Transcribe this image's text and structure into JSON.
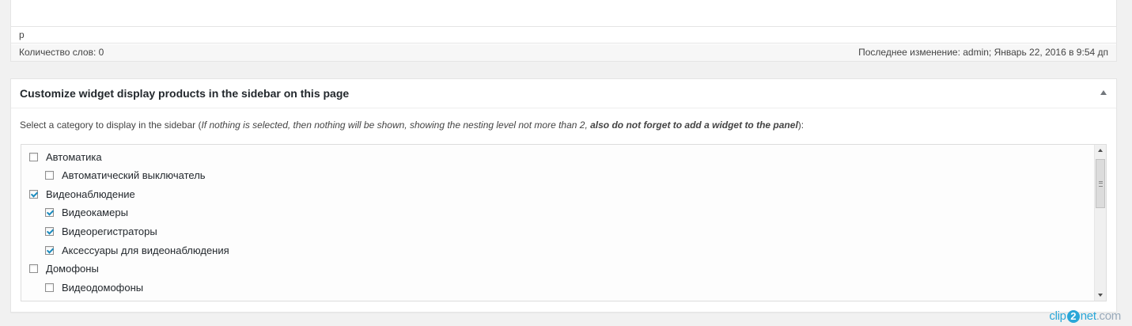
{
  "editor": {
    "path": "p",
    "word_count": "Количество слов: 0",
    "last_modified": "Последнее изменение: admin; Январь 22, 2016 в 9:54 дп"
  },
  "metabox": {
    "title": "Customize widget display products in the sidebar on this page",
    "instruction": {
      "lead": "Select a category to display in the sidebar (",
      "italic": "If nothing is selected, then nothing will be shown, showing the nesting level not more than 2, ",
      "bold_italic": "also do not forget to add a widget to the panel",
      "tail": "):"
    },
    "categories": [
      {
        "label": "Автоматика",
        "checked": false,
        "level": 0
      },
      {
        "label": "Автоматический выключатель",
        "checked": false,
        "level": 1
      },
      {
        "label": "Видеонаблюдение",
        "checked": true,
        "level": 0
      },
      {
        "label": "Видеокамеры",
        "checked": true,
        "level": 1
      },
      {
        "label": "Видеорегистраторы",
        "checked": true,
        "level": 1
      },
      {
        "label": "Аксессуары для видеонаблюдения",
        "checked": true,
        "level": 1
      },
      {
        "label": "Домофоны",
        "checked": false,
        "level": 0
      },
      {
        "label": "Видеодомофоны",
        "checked": false,
        "level": 1
      },
      {
        "label": "",
        "checked": false,
        "level": 1
      }
    ]
  },
  "watermark": {
    "pre": "clip",
    "num": "2",
    "post": "net",
    "domain": ".com"
  },
  "colors": {
    "accent": "#1e8cbe",
    "watermark": "#2aa7d8"
  }
}
